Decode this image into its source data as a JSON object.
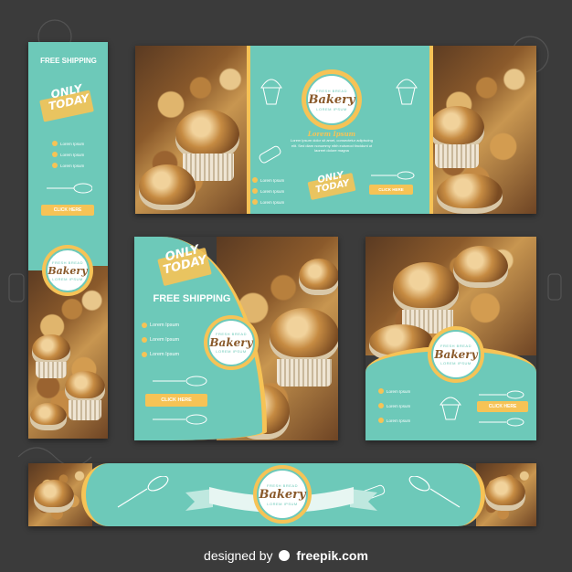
{
  "banners": {
    "skyscraper": {
      "free_shipping": "FREE SHIPPING",
      "only_today_line1": "ONLY",
      "only_today_line2": "TODAY",
      "contact": [
        "Lorem Ipsum",
        "Lorem Ipsum",
        "Lorem Ipsum"
      ],
      "button": "CLICK HERE",
      "logo_top": "FRESH BREAD",
      "logo_text": "Bakery",
      "logo_bottom": "LOREM IPSUM"
    },
    "leaderboard": {
      "logo_top": "FRESH BREAD",
      "logo_text": "Bakery",
      "logo_bottom": "LOREM IPSUM",
      "headline": "Lorem Ipsum",
      "body": "Lorem ipsum dolor sit amet, consectetur adipiscing elit. Sed diam nonummy nibh euismod tincidunt ut laoreet dolore magna",
      "contact": [
        "Lorem Ipsum",
        "Lorem Ipsum",
        "Lorem Ipsum"
      ],
      "only_today_line1": "ONLY",
      "only_today_line2": "TODAY",
      "button": "CLICK HERE"
    },
    "square": {
      "only_today_line1": "ONLY",
      "only_today_line2": "TODAY",
      "free_shipping": "FREE SHIPPING",
      "contact": [
        "Lorem Ipsum",
        "Lorem Ipsum",
        "Lorem Ipsum"
      ],
      "button": "CLICK HERE",
      "logo_top": "FRESH BREAD",
      "logo_text": "Bakery",
      "logo_bottom": "LOREM IPSUM"
    },
    "small_square": {
      "logo_top": "FRESH BREAD",
      "logo_text": "Bakery",
      "logo_bottom": "LOREM IPSUM",
      "contact": [
        "Lorem Ipsum",
        "Lorem Ipsum",
        "Lorem Ipsum"
      ],
      "button": "CLICK HERE"
    },
    "bottom": {
      "logo_top": "FRESH BREAD",
      "logo_text": "Bakery",
      "logo_bottom": "LOREM IPSUM"
    }
  },
  "footer": {
    "prefix": "designed by",
    "brand": "freepik.com"
  },
  "colors": {
    "teal": "#6dc9b9",
    "yellow": "#f6c356",
    "background": "#3b3b3b",
    "brown": "#8a5a2b"
  },
  "icons": [
    "whatsapp-icon",
    "facebook-icon",
    "instagram-icon",
    "whisk-icon",
    "rolling-pin-icon",
    "cupcake-icon",
    "freepik-logo-icon"
  ]
}
